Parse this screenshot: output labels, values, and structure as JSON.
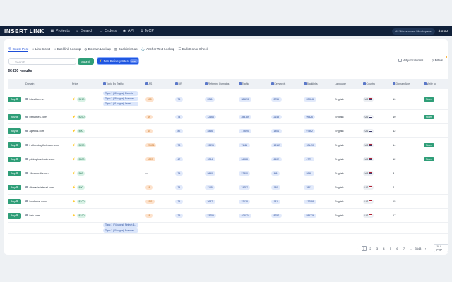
{
  "topbar": {
    "logo": "INSERT LINK",
    "nav": [
      {
        "icon": "grid-icon",
        "label": "Projects"
      },
      {
        "icon": "search-icon",
        "label": "Search"
      },
      {
        "icon": "cart-icon",
        "label": "Orders"
      },
      {
        "icon": "code-icon",
        "label": "API"
      },
      {
        "icon": "plug-icon",
        "label": "MCP"
      }
    ],
    "workspace": "All Workspaces / Workspace",
    "balance": "$ 0.00"
  },
  "tabs": [
    {
      "label": "Guest Post",
      "active": true
    },
    {
      "label": "Link Insert"
    },
    {
      "label": "Backlink Lookup"
    },
    {
      "label": "Domain Lookup"
    },
    {
      "label": "Backlink Gap"
    },
    {
      "label": "Anchor Text Lookup"
    },
    {
      "label": "Bulk Donor Check"
    }
  ],
  "search": {
    "placeholder": "Search"
  },
  "submit_label": "Submit",
  "fast_label": "Fast Delivery Sites",
  "fast_badge": "NEW",
  "adjust_label": "Adjust columns",
  "filters_label": "Filters",
  "results_label": "36430 results",
  "columns": [
    "Domain",
    "Price",
    "Topic By Traffic",
    "AS",
    "DR",
    "Referring Domains",
    "Traffic",
    "Keywords",
    "Backlinks",
    "Language",
    "Country",
    "Domain Age",
    "Write to"
  ],
  "buy_label": "Buy",
  "rows": [
    {
      "domain": "bitcation.net",
      "price": "$210",
      "topics": [
        "Topic 1 (98 pages): Birocoin...",
        "Topic 2 (48 pages): Business...",
        "Topic 3 (91 pages): Invest..."
      ],
      "as": "100",
      "dr": "74",
      "rd": "2211",
      "traffic": "386291",
      "kw": "2756",
      "bl": "220846",
      "lang": "English",
      "country": "US",
      "age": "10",
      "status": "Notes"
    },
    {
      "domain": "bitnames.com",
      "price": "$250",
      "topics": [],
      "as": "49",
      "dr": "74",
      "rd": "12466",
      "traffic": "283789",
      "kw": "2148",
      "bl": "99826",
      "lang": "English",
      "country": "US",
      "age": "10",
      "status": "Notes"
    },
    {
      "domain": "apeeks.com",
      "price": "$90",
      "topics": [],
      "as": "44",
      "dr": "82",
      "rd": "4866",
      "traffic": "179890",
      "kw": "1801",
      "bl": "97862",
      "lang": "English",
      "country": "US",
      "age": "12",
      "status": ""
    },
    {
      "domain": "in-thinkingthefuture.com",
      "price": "$250",
      "topics": [],
      "as": "27496",
      "dr": "73",
      "rd": "13895",
      "traffic": "71111",
      "kw": "13159",
      "bl": "121490",
      "lang": "English",
      "country": "US",
      "age": "14",
      "status": "Notes"
    },
    {
      "domain": "pickupinsstsale.com",
      "price": "$500",
      "topics": [],
      "as": "1507",
      "dr": "47",
      "rd": "1284",
      "traffic": "34988",
      "kw": "6602",
      "bl": "4779",
      "lang": "English",
      "country": "US",
      "age": "12",
      "status": "Notes"
    },
    {
      "domain": "vibramedia.com",
      "price": "$80",
      "topics": [],
      "as": "—",
      "dr": "74",
      "rd": "3650",
      "traffic": "97800",
      "kw": "111",
      "bl": "3058",
      "lang": "English",
      "country": "US",
      "age": "3",
      "status": ""
    },
    {
      "domain": "dienadaliatroat.com",
      "price": "$90",
      "topics": [],
      "as": "18",
      "dr": "74",
      "rd": "1185",
      "traffic": "74797",
      "kw": "180",
      "bl": "3861",
      "lang": "English",
      "country": "US",
      "age": "2",
      "status": ""
    },
    {
      "domain": "bookntre.com",
      "price": "$100",
      "topics": [],
      "as": "1111",
      "dr": "74",
      "rd": "3687",
      "traffic": "22138",
      "kw": "181",
      "bl": "127098",
      "lang": "English",
      "country": "US",
      "age": "15",
      "status": ""
    },
    {
      "domain": "itsb.com",
      "price": "$190",
      "topics": [],
      "as": "18",
      "dr": "75",
      "rd": "23759",
      "traffic": "405074",
      "kw": "8757",
      "bl": "585226",
      "lang": "English",
      "country": "US",
      "age": "17",
      "status": ""
    },
    {
      "domain": "",
      "price": "",
      "topics": [
        "Topic 1 (74 pages): Fintech &...",
        "Topic 2 (20 pages): Business..."
      ],
      "as": "",
      "dr": "",
      "rd": "",
      "traffic": "",
      "kw": "",
      "bl": "",
      "lang": "",
      "country": "",
      "age": "",
      "status": ""
    }
  ],
  "pager": {
    "pages": [
      "1",
      "2",
      "3",
      "4",
      "5",
      "6",
      "7",
      "...",
      "3643"
    ],
    "current": "1",
    "per_page": "10 / page"
  },
  "colors": {
    "nav_bg": "#11213a",
    "accent": "#1f56e0",
    "buy": "#2f9e78"
  }
}
